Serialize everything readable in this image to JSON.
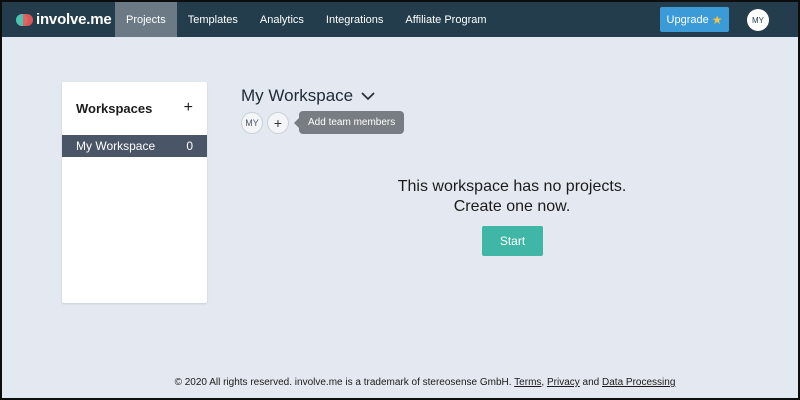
{
  "brand": {
    "name": "involve.me",
    "colors": {
      "nav_bg": "#233d4c",
      "accent": "#3fb6a6",
      "upgrade": "#3a9bd8"
    }
  },
  "nav": {
    "items": [
      {
        "label": "Projects",
        "active": true
      },
      {
        "label": "Templates",
        "active": false
      },
      {
        "label": "Analytics",
        "active": false
      },
      {
        "label": "Integrations",
        "active": false
      },
      {
        "label": "Affiliate Program",
        "active": false
      }
    ],
    "upgrade_label": "Upgrade",
    "upgrade_icon": "star-icon",
    "user_initials": "MY"
  },
  "sidebar": {
    "title": "Workspaces",
    "add_icon": "plus-icon",
    "items": [
      {
        "label": "My Workspace",
        "count": "0"
      }
    ]
  },
  "workspace": {
    "title": "My Workspace",
    "members": [
      "MY"
    ],
    "add_member_icon": "plus-icon",
    "tooltip": "Add team members"
  },
  "empty_state": {
    "line1": "This workspace has no projects.",
    "line2": "Create one now.",
    "start_label": "Start"
  },
  "footer": {
    "text": "© 2020 All rights reserved. involve.me is a trademark of stereosense GmbH.",
    "links": {
      "terms": "Terms",
      "privacy": "Privacy",
      "and": "and",
      "data_processing": "Data Processing"
    }
  }
}
